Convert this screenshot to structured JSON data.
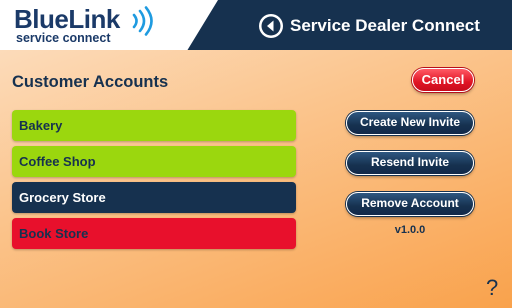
{
  "header": {
    "logo": {
      "brand": "BlueLink",
      "tagline": "service connect"
    },
    "back_icon": "back-arrow-icon",
    "title": "Service Dealer Connect"
  },
  "main": {
    "section_title": "Customer Accounts",
    "cancel_label": "Cancel",
    "accounts": [
      {
        "label": "Bakery",
        "color": "#9bd70e"
      },
      {
        "label": "Coffee Shop",
        "color": "#9bd70e"
      },
      {
        "label": "Grocery Store",
        "color": "#16314f",
        "selected": true
      },
      {
        "label": "Book Store",
        "color": "#e8102c"
      }
    ],
    "actions": {
      "create_invite": "Create New Invite",
      "resend_invite": "Resend Invite",
      "remove_account": "Remove Account"
    },
    "version": "v1.0.0",
    "help_label": "?"
  },
  "colors": {
    "navy": "#16314f",
    "accent_orange": "#f9a24c",
    "green": "#9bd70e",
    "red": "#e8102c",
    "cancel_red": "#e01424"
  }
}
